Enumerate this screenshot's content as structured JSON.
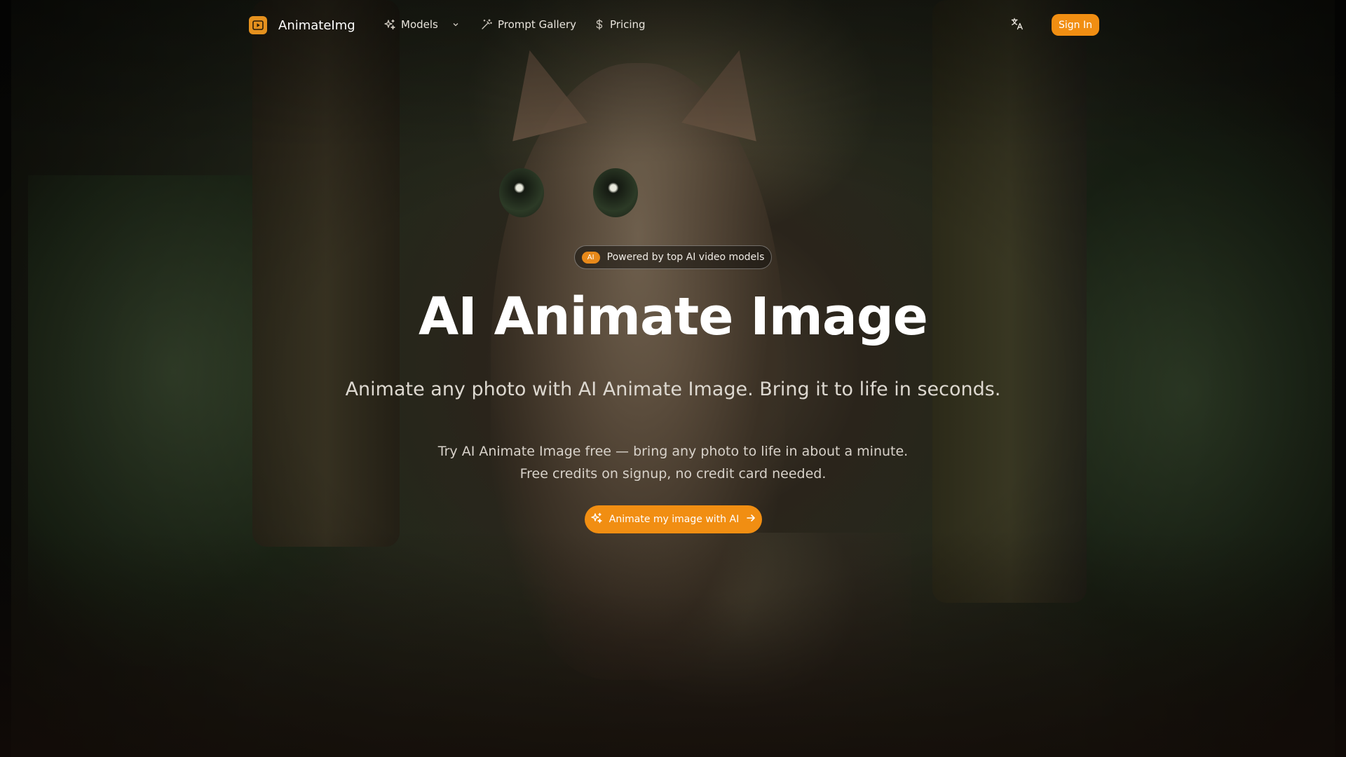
{
  "brand": {
    "name": "AnimateImg",
    "accent_color": "#f18e12",
    "logo_icon": "play-frame-icon"
  },
  "nav": {
    "items": [
      {
        "label": "Models",
        "icon": "sparkles-icon",
        "has_dropdown": true
      },
      {
        "label": "Prompt Gallery",
        "icon": "magic-wand-icon"
      },
      {
        "label": "Pricing",
        "icon": "dollar-icon"
      }
    ],
    "language_icon": "translate-icon",
    "sign_in_label": "Sign In"
  },
  "hero": {
    "badge_chip": "AI",
    "badge_text": "Powered by top AI video models",
    "title": "AI Animate Image",
    "subtitle": "Animate any photo with AI Animate Image. Bring it to life in seconds.",
    "description_line1": "Try AI Animate Image free — bring any photo to life in about a minute.",
    "description_line2": "Free credits on signup, no credit card needed.",
    "cta_label": "Animate my image with AI",
    "cta_icon": "sparkles-icon",
    "cta_trailing_icon": "arrow-right-icon"
  }
}
